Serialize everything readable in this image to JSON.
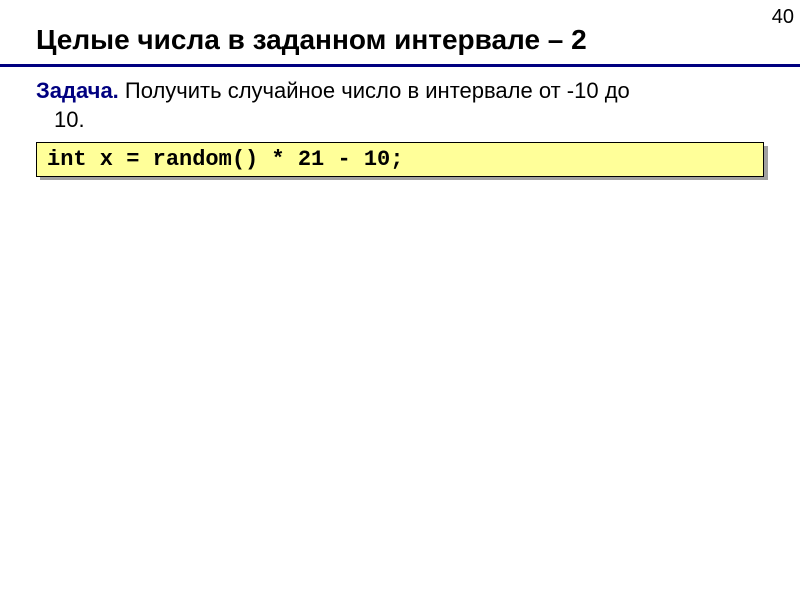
{
  "page_number": "40",
  "title": "Целые числа в заданном интервале – 2",
  "problem": {
    "label": "Задача.",
    "text_line1": " Получить случайное число в интервале от -10 до",
    "text_line2": "10."
  },
  "code": "int x = random() * 21 - 10;"
}
